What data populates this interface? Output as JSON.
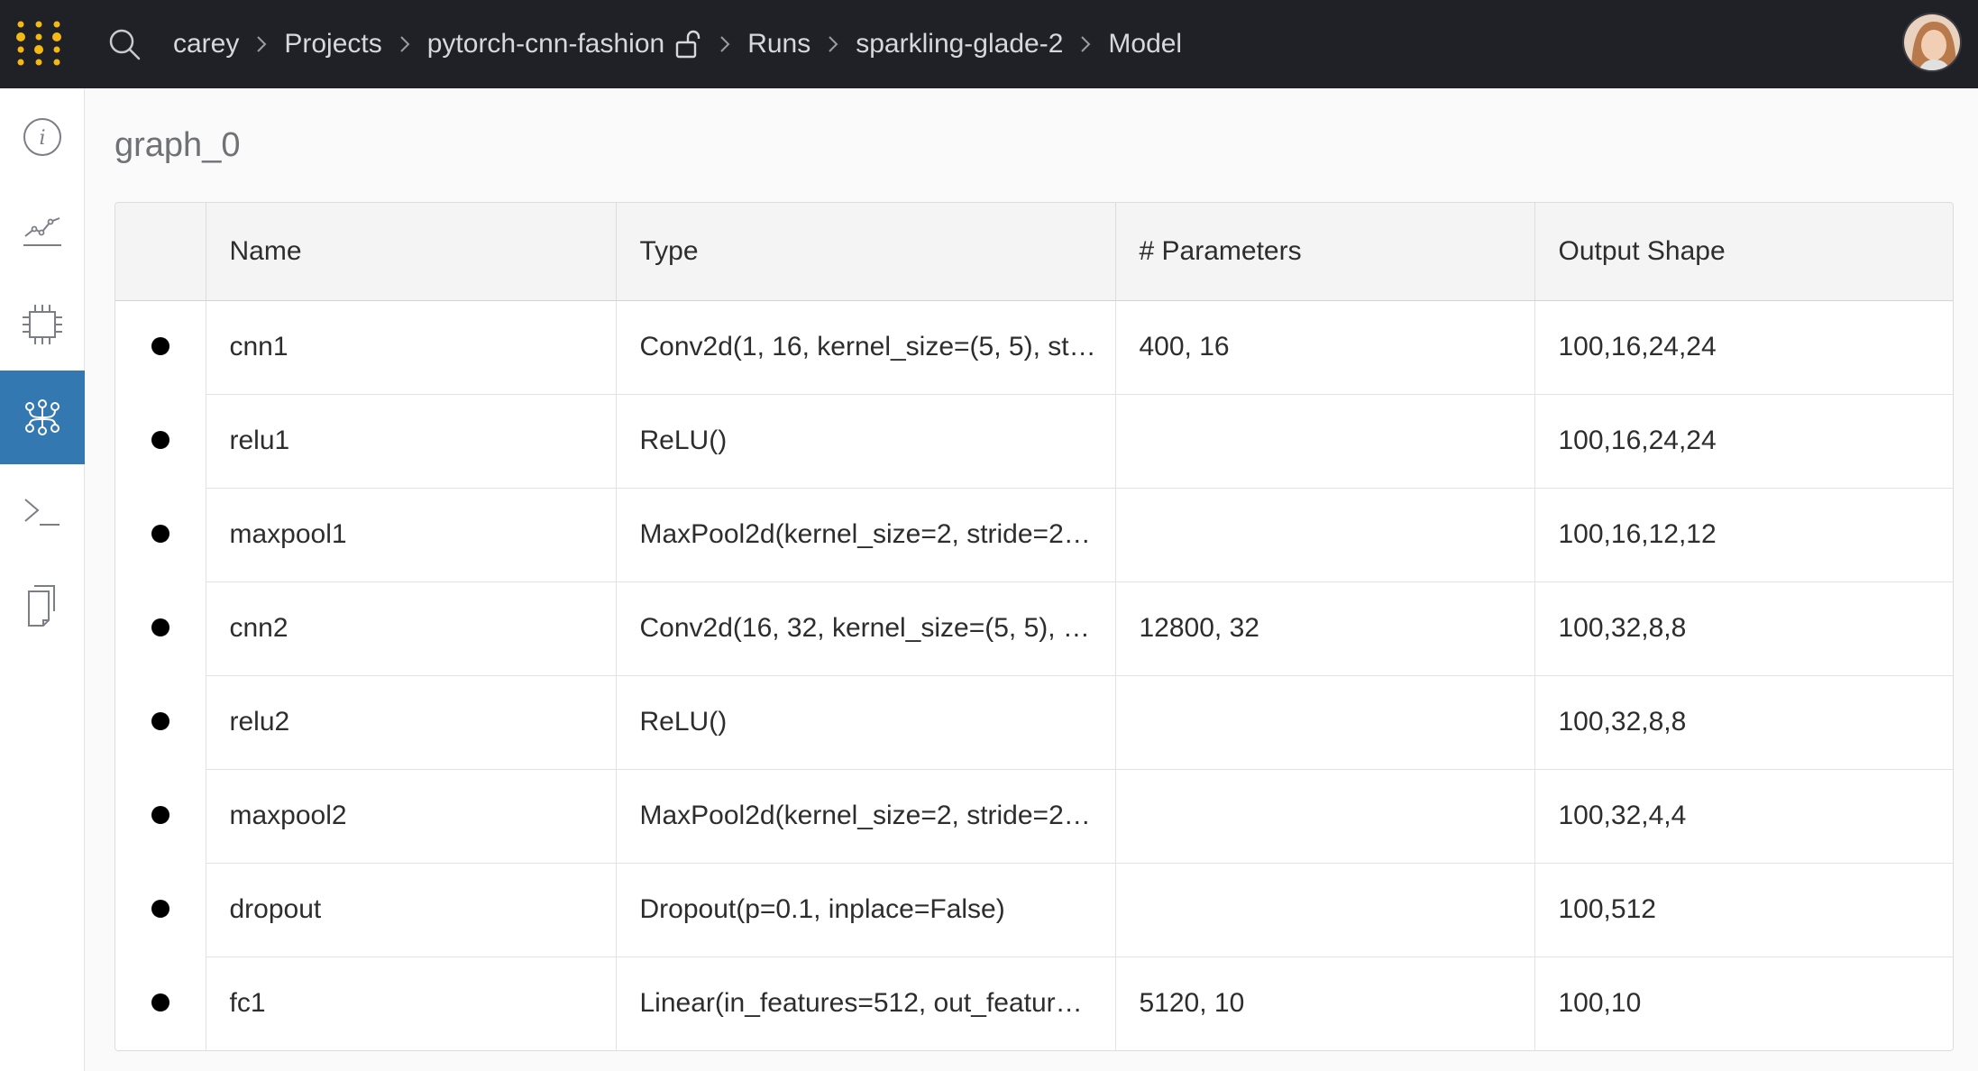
{
  "header": {
    "logo_icon": "wandb-logo-icon",
    "breadcrumb": [
      "carey",
      "Projects",
      "pytorch-cnn-fashion",
      "Runs",
      "sparkling-glade-2",
      "Model"
    ],
    "accent": "#f5b915"
  },
  "sidebar": {
    "items": [
      {
        "icon": "info-icon",
        "active": false
      },
      {
        "icon": "charts-icon",
        "active": false
      },
      {
        "icon": "system-chip-icon",
        "active": false
      },
      {
        "icon": "model-icon",
        "active": true
      },
      {
        "icon": "logs-terminal-icon",
        "active": false
      },
      {
        "icon": "files-icon",
        "active": false
      }
    ],
    "active_color": "#3378b0"
  },
  "main": {
    "title": "graph_0",
    "table": {
      "columns": [
        "",
        "Name",
        "Type",
        "# Parameters",
        "Output Shape"
      ],
      "rows": [
        {
          "name": "cnn1",
          "type": "Conv2d(1, 16, kernel_size=(5, 5), st…",
          "params": "400, 16",
          "shape": "100,16,24,24"
        },
        {
          "name": "relu1",
          "type": "ReLU()",
          "params": "",
          "shape": "100,16,24,24"
        },
        {
          "name": "maxpool1",
          "type": "MaxPool2d(kernel_size=2, stride=2…",
          "params": "",
          "shape": "100,16,12,12"
        },
        {
          "name": "cnn2",
          "type": "Conv2d(16, 32, kernel_size=(5, 5), …",
          "params": "12800, 32",
          "shape": "100,32,8,8"
        },
        {
          "name": "relu2",
          "type": "ReLU()",
          "params": "",
          "shape": "100,32,8,8"
        },
        {
          "name": "maxpool2",
          "type": "MaxPool2d(kernel_size=2, stride=2…",
          "params": "",
          "shape": "100,32,4,4"
        },
        {
          "name": "dropout",
          "type": "Dropout(p=0.1, inplace=False)",
          "params": "",
          "shape": "100,512"
        },
        {
          "name": "fc1",
          "type": "Linear(in_features=512, out_featur…",
          "params": "5120, 10",
          "shape": "100,10"
        }
      ]
    }
  }
}
